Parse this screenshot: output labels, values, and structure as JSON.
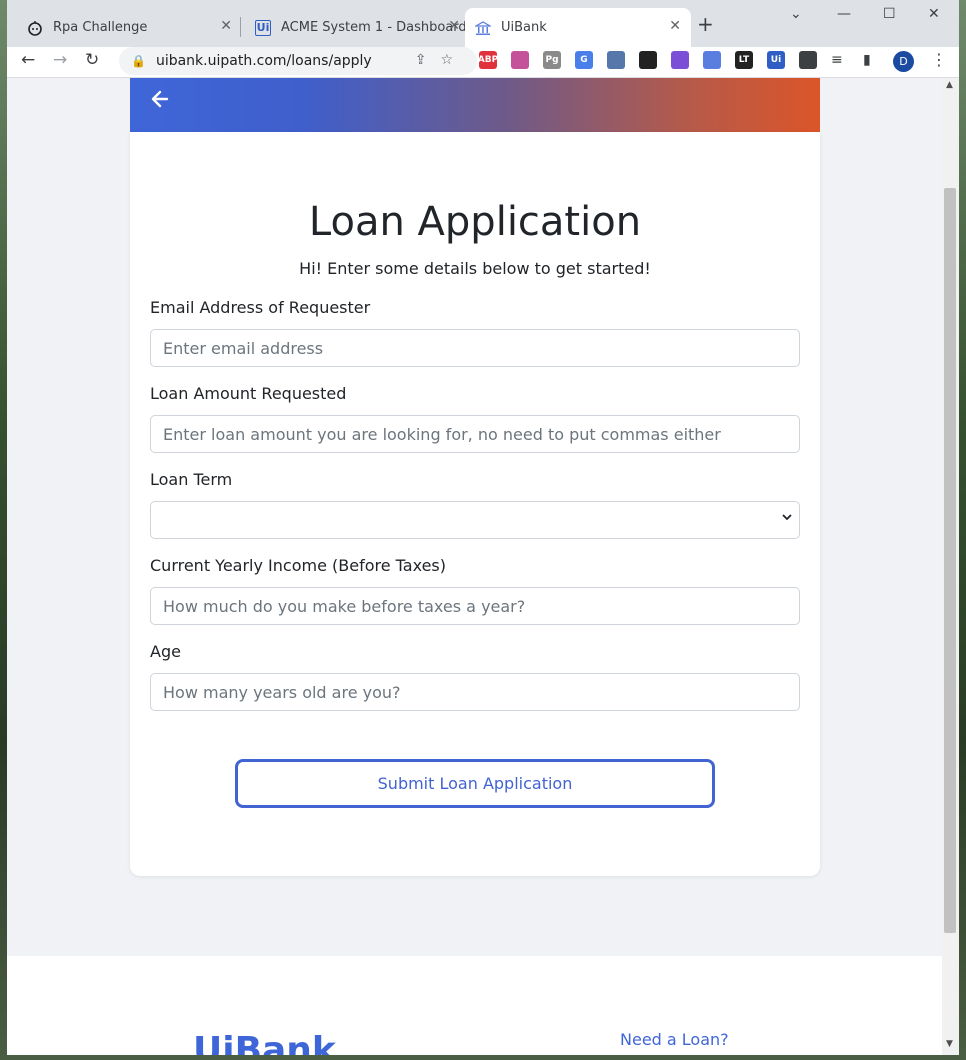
{
  "browser": {
    "tabs": [
      {
        "title": "Rpa Challenge",
        "icon": "robot-icon"
      },
      {
        "title": "ACME System 1 - Dashboard",
        "icon": "uipath-icon"
      },
      {
        "title": "UiBank",
        "icon": "bank-icon"
      }
    ],
    "url": "uibank.uipath.com/loans/apply",
    "profile_initial": "D",
    "extensions": [
      {
        "name": "adblock-icon",
        "label": "ABP",
        "color": "#e0323c"
      },
      {
        "name": "gradient-ext-icon",
        "label": "",
        "color": "#c3529a"
      },
      {
        "name": "pg-icon",
        "label": "Pg",
        "color": "#8a8a8a"
      },
      {
        "name": "translate-icon",
        "label": "G",
        "color": "#4a7ee8"
      },
      {
        "name": "circle-ext-icon",
        "label": "",
        "color": "#5577aa"
      },
      {
        "name": "paw-icon",
        "label": "",
        "color": "#222222"
      },
      {
        "name": "feather-icon",
        "label": "",
        "color": "#7b4fd6"
      },
      {
        "name": "chevron-ext-icon",
        "label": "",
        "color": "#5a7de0"
      },
      {
        "name": "languagetool-icon",
        "label": "LT",
        "color": "#222222"
      },
      {
        "name": "uipath-ext-icon",
        "label": "Ui",
        "color": "#2f5fc4"
      },
      {
        "name": "puzzle-icon",
        "label": "",
        "color": "#3c4043"
      }
    ]
  },
  "form": {
    "title": "Loan Application",
    "subtitle": "Hi! Enter some details below to get started!",
    "fields": {
      "email": {
        "label": "Email Address of Requester",
        "placeholder": "Enter email address"
      },
      "amount": {
        "label": "Loan Amount Requested",
        "placeholder": "Enter loan amount you are looking for, no need to put commas either"
      },
      "term": {
        "label": "Loan Term",
        "value": ""
      },
      "income": {
        "label": "Current Yearly Income (Before Taxes)",
        "placeholder": "How much do you make before taxes a year?"
      },
      "age": {
        "label": "Age",
        "placeholder": "How many years old are you?"
      }
    },
    "submit_label": "Submit Loan Application"
  },
  "footer": {
    "logo_text": "UiBank",
    "link": "Need a Loan?"
  },
  "colors": {
    "accent": "#4263d2",
    "banner_start": "#3f66d8",
    "banner_end": "#dc5529"
  }
}
